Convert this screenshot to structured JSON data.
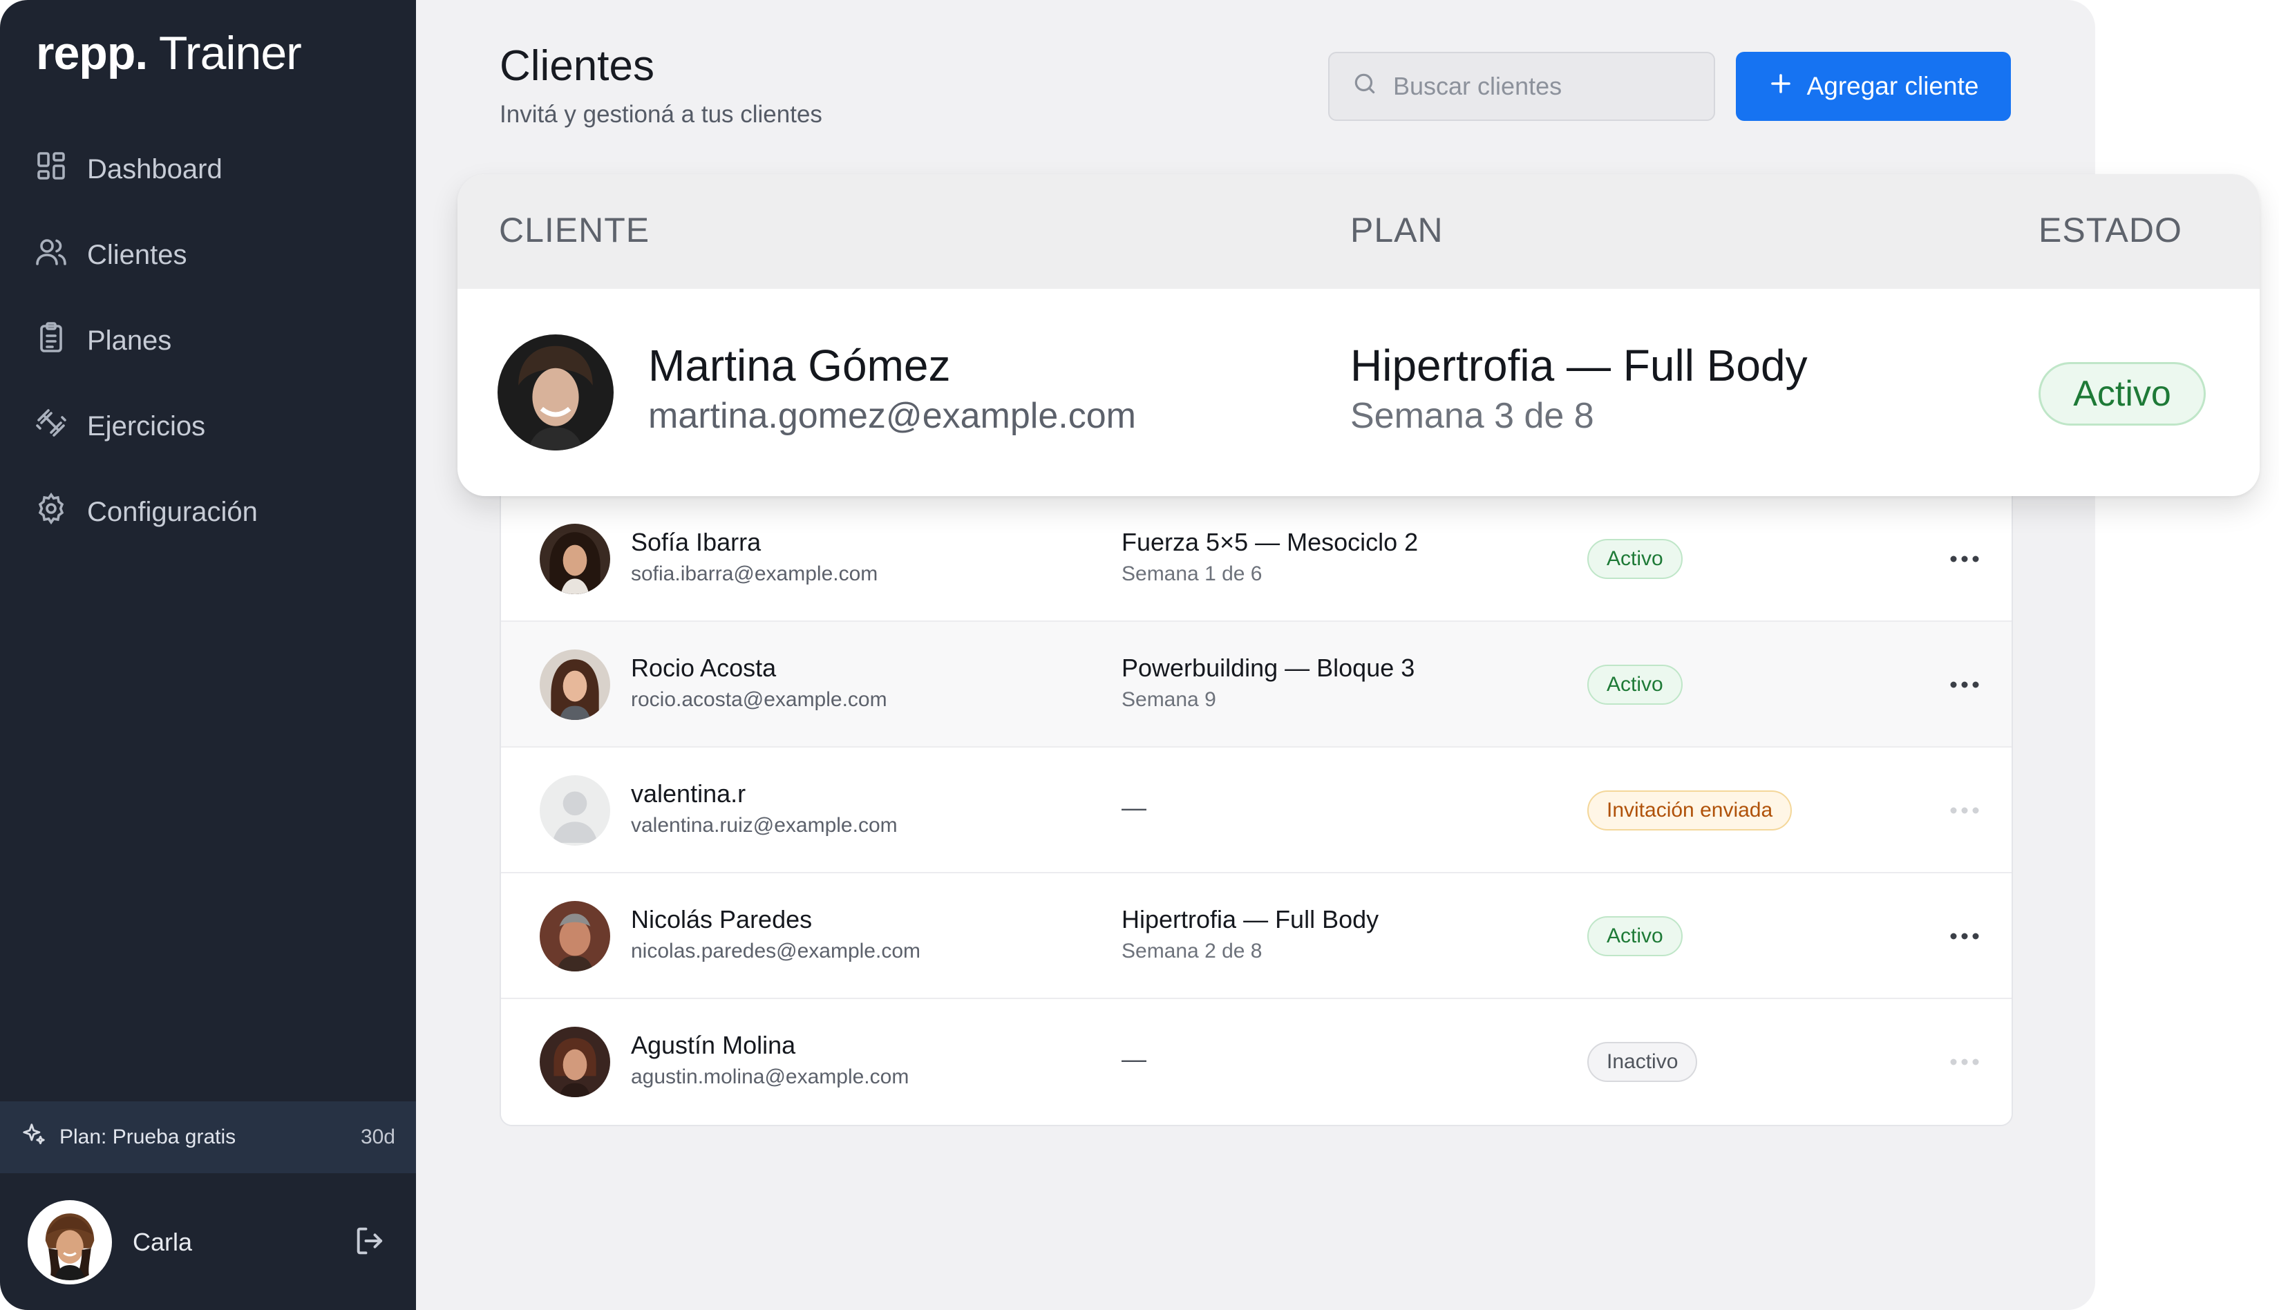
{
  "app": {
    "logo_bold": "repp.",
    "logo_light": "Trainer"
  },
  "sidebar": {
    "items": [
      {
        "label": "Dashboard",
        "icon": "grid-icon"
      },
      {
        "label": "Clientes",
        "icon": "users-icon"
      },
      {
        "label": "Planes",
        "icon": "clipboard-icon"
      },
      {
        "label": "Ejercicios",
        "icon": "dumbbell-icon"
      },
      {
        "label": "Configuración",
        "icon": "gear-icon"
      }
    ],
    "plan": {
      "label": "Plan: Prueba gratis",
      "days": "30d",
      "icon": "sparkles-icon"
    },
    "user": {
      "name": "Carla",
      "logout_icon": "logout-icon"
    }
  },
  "header": {
    "title": "Clientes",
    "subtitle": "Invitá y gestioná a tus clientes",
    "search_placeholder": "Buscar clientes",
    "add_button": "Agregar cliente"
  },
  "table": {
    "columns": {
      "client": "CLIENTE",
      "plan": "PLAN",
      "status": "ESTADO"
    },
    "highlight": {
      "name": "Martina Gómez",
      "email": "martina.gomez@example.com",
      "plan": "Hipertrofia — Full Body",
      "week": "Semana 3 de 8",
      "status": "Activo"
    },
    "rows": [
      {
        "name": "Sofía Ibarra",
        "email": "sofia.ibarra@example.com",
        "plan": "Fuerza 5×5 — Mesociclo 2",
        "week": "Semana 1 de 6",
        "status": "Activo"
      },
      {
        "name": "Rocio Acosta",
        "email": "rocio.acosta@example.com",
        "plan": "Powerbuilding — Bloque 3",
        "week": "Semana 9",
        "status": "Activo"
      },
      {
        "name": "valentina.r",
        "email": "valentina.ruiz@example.com",
        "plan": "—",
        "week": "",
        "status": "Invitación enviada"
      },
      {
        "name": "Nicolás Paredes",
        "email": "nicolas.paredes@example.com",
        "plan": "Hipertrofia — Full Body",
        "week": "Semana 2 de 8",
        "status": "Activo"
      },
      {
        "name": "Agustín Molina",
        "email": "agustin.molina@example.com",
        "plan": "—",
        "week": "",
        "status": "Inactivo"
      }
    ]
  },
  "colors": {
    "sidebar_bg": "#1e2430",
    "accent": "#1673f2",
    "active": "#1e7a37",
    "invite": "#b0520a"
  }
}
